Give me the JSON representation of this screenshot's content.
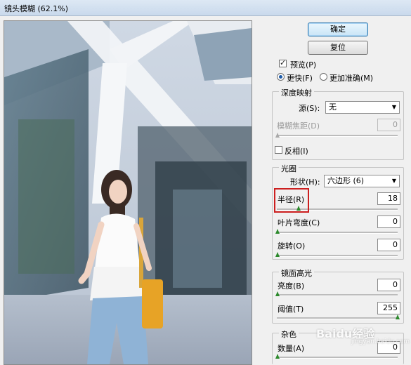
{
  "window": {
    "title": "镜头模糊 (62.1%)"
  },
  "buttons": {
    "ok": "确定",
    "reset": "复位"
  },
  "preview_option": {
    "label": "预览(P)",
    "checked": true
  },
  "quality": {
    "faster": "更快(F)",
    "more_accurate": "更加准确(M)",
    "selected": "faster"
  },
  "depth_map": {
    "title": "深度映射",
    "source_label": "源(S):",
    "source_value": "无",
    "blur_focal_label": "模糊焦距(D)",
    "blur_focal_value": "0",
    "invert_label": "反相(I)"
  },
  "iris": {
    "title": "光圈",
    "shape_label": "形状(H):",
    "shape_value": "六边形 (6)",
    "radius_label": "半径(R)",
    "radius_value": "18",
    "curvature_label": "叶片弯度(C)",
    "curvature_value": "0",
    "rotation_label": "旋转(O)",
    "rotation_value": "0"
  },
  "specular": {
    "title": "镜面高光",
    "brightness_label": "亮度(B)",
    "brightness_value": "0",
    "threshold_label": "阈值(T)",
    "threshold_value": "255"
  },
  "noise": {
    "title": "杂色",
    "amount_label": "数量(A)",
    "amount_value": "0"
  },
  "watermark": {
    "text": "Baidu经验",
    "sub": "jingyan.baidu.com"
  }
}
